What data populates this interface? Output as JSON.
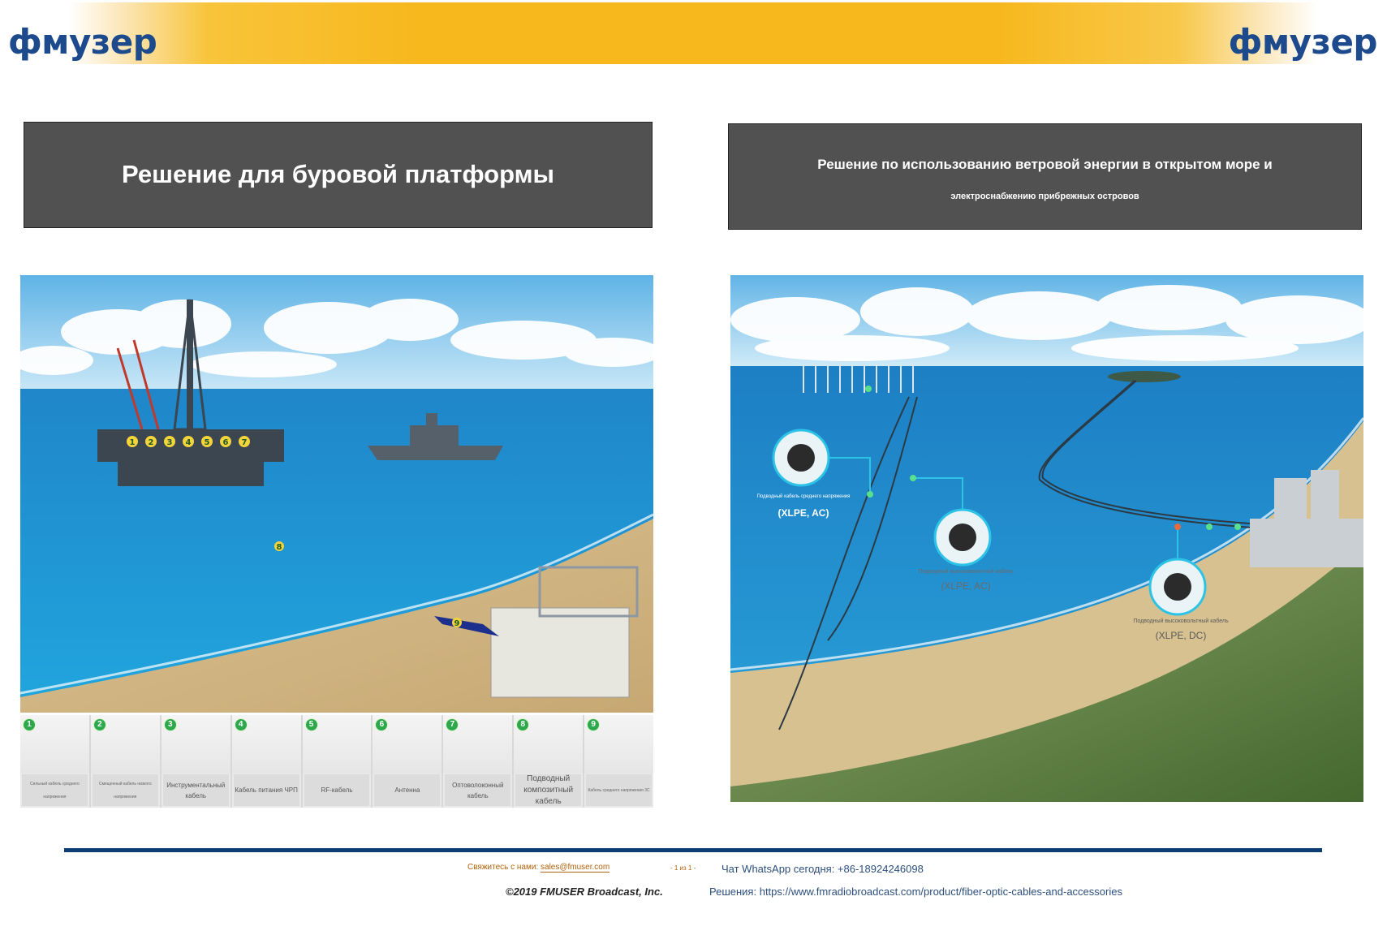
{
  "header": {
    "logo_left": "фмузер",
    "logo_right": "фмузер"
  },
  "left_panel": {
    "title": "Решение для буровой платформы",
    "markers": [
      "1",
      "2",
      "3",
      "4",
      "5",
      "6",
      "7",
      "8",
      "9"
    ],
    "cables": [
      {
        "num": "1",
        "label": "Сильный кабель среднего напряжения"
      },
      {
        "num": "2",
        "label": "Смещенный кабель низкого напряжения"
      },
      {
        "num": "3",
        "label": "Инструментальный кабель"
      },
      {
        "num": "4",
        "label": "Кабель питания ЧРП"
      },
      {
        "num": "5",
        "label": "RF-кабель"
      },
      {
        "num": "6",
        "label": "Антенна"
      },
      {
        "num": "7",
        "label": "Оптоволоконный кабель"
      },
      {
        "num": "8",
        "label": "Подводный композитный кабель"
      },
      {
        "num": "9",
        "label": "Кабель среднего напряжения 3С"
      }
    ]
  },
  "right_panel": {
    "title_line1": "Решение по использованию ветровой энергии в открытом море и",
    "title_line2": "электроснабжению прибрежных островов",
    "callouts": [
      {
        "caption": "Подводный кабель среднего напряжения",
        "spec": "(XLPE, AC)"
      },
      {
        "caption": "Подводный высоковольтный кабель",
        "spec": "(XLPE, AC)"
      },
      {
        "caption": "Подводный высоковольтный кабель",
        "spec": "(XLPE, DC)"
      }
    ]
  },
  "footer": {
    "contact_label": "Свяжитесь с нами:",
    "contact_email": "sales@fmuser.com",
    "page_indicator": "- 1 из 1 -",
    "whatsapp": "Чат WhatsApp сегодня: +86-18924246098",
    "copyright": "©2019 FMUSER Broadcast, Inc.",
    "solutions_label": "Решения:",
    "solutions_url": "https://www.fmradiobroadcast.com/product/fiber-optic-cables-and-accessories"
  },
  "colors": {
    "brand_blue": "#1d4a8c",
    "banner_gold": "#f7b81e",
    "title_gray": "#515151",
    "footer_rule": "#0d3e73",
    "marker_green": "#2ea84c"
  }
}
